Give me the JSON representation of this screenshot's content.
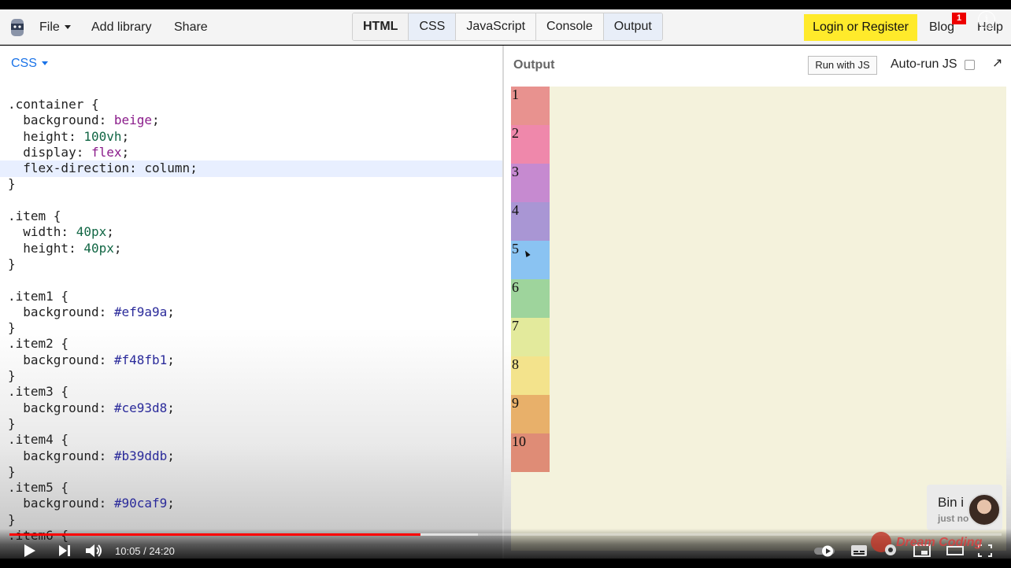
{
  "toolbar": {
    "file_label": "File",
    "add_library_label": "Add library",
    "share_label": "Share",
    "tabs": [
      "HTML",
      "CSS",
      "JavaScript",
      "Console",
      "Output"
    ],
    "login_label": "Login or Register",
    "blog_label": "Blog",
    "blog_badge": "1",
    "help_label": "Help",
    "info_icon": "i"
  },
  "editor": {
    "language_label": "CSS",
    "code": [
      [
        {
          "t": ".container {"
        }
      ],
      [
        {
          "t": "  background: "
        },
        {
          "t": "beige",
          "c": "kw"
        },
        {
          "t": ";"
        }
      ],
      [
        {
          "t": "  height: "
        },
        {
          "t": "100vh",
          "c": "num"
        },
        {
          "t": ";"
        }
      ],
      [
        {
          "t": "  display: "
        },
        {
          "t": "flex",
          "c": "kw"
        },
        {
          "t": ";"
        }
      ],
      [
        {
          "t": "  flex-direction: column;"
        }
      ],
      [
        {
          "t": "}"
        }
      ],
      [
        {
          "t": ""
        }
      ],
      [
        {
          "t": ".item {"
        }
      ],
      [
        {
          "t": "  width: "
        },
        {
          "t": "40px",
          "c": "num"
        },
        {
          "t": ";"
        }
      ],
      [
        {
          "t": "  height: "
        },
        {
          "t": "40px",
          "c": "num"
        },
        {
          "t": ";"
        }
      ],
      [
        {
          "t": "}"
        }
      ],
      [
        {
          "t": ""
        }
      ],
      [
        {
          "t": ".item1 {"
        }
      ],
      [
        {
          "t": "  background: "
        },
        {
          "t": "#ef9a9a",
          "c": "hex"
        },
        {
          "t": ";"
        }
      ],
      [
        {
          "t": "}"
        }
      ],
      [
        {
          "t": ".item2 {"
        }
      ],
      [
        {
          "t": "  background: "
        },
        {
          "t": "#f48fb1",
          "c": "hex"
        },
        {
          "t": ";"
        }
      ],
      [
        {
          "t": "}"
        }
      ],
      [
        {
          "t": ".item3 {"
        }
      ],
      [
        {
          "t": "  background: "
        },
        {
          "t": "#ce93d8",
          "c": "hex"
        },
        {
          "t": ";"
        }
      ],
      [
        {
          "t": "}"
        }
      ],
      [
        {
          "t": ".item4 {"
        }
      ],
      [
        {
          "t": "  background: "
        },
        {
          "t": "#b39ddb",
          "c": "hex"
        },
        {
          "t": ";"
        }
      ],
      [
        {
          "t": "}"
        }
      ],
      [
        {
          "t": ".item5 {"
        }
      ],
      [
        {
          "t": "  background: "
        },
        {
          "t": "#90caf9",
          "c": "hex"
        },
        {
          "t": ";"
        }
      ],
      [
        {
          "t": "}"
        }
      ],
      [
        {
          "t": ".item6 {"
        }
      ]
    ]
  },
  "output": {
    "label": "Output",
    "run_button": "Run with JS",
    "autorun_label": "Auto-run JS",
    "popout_icon": "↗",
    "items": [
      {
        "label": "1",
        "color": "#e8928f"
      },
      {
        "label": "2",
        "color": "#ef88ab"
      },
      {
        "label": "3",
        "color": "#c68ad0"
      },
      {
        "label": "4",
        "color": "#a996d4"
      },
      {
        "label": "5",
        "color": "#8ac3f2"
      },
      {
        "label": "6",
        "color": "#9ed49c"
      },
      {
        "label": "7",
        "color": "#e3ea9c"
      },
      {
        "label": "8",
        "color": "#f3e38c"
      },
      {
        "label": "9",
        "color": "#e8b06a"
      },
      {
        "label": "10",
        "color": "#df8c76"
      }
    ]
  },
  "channel_card": {
    "name": "Bin i",
    "sub": "just no"
  },
  "player": {
    "time": "10:05 / 24:20",
    "progress": 0.414,
    "watermark": "Dream Coding"
  }
}
